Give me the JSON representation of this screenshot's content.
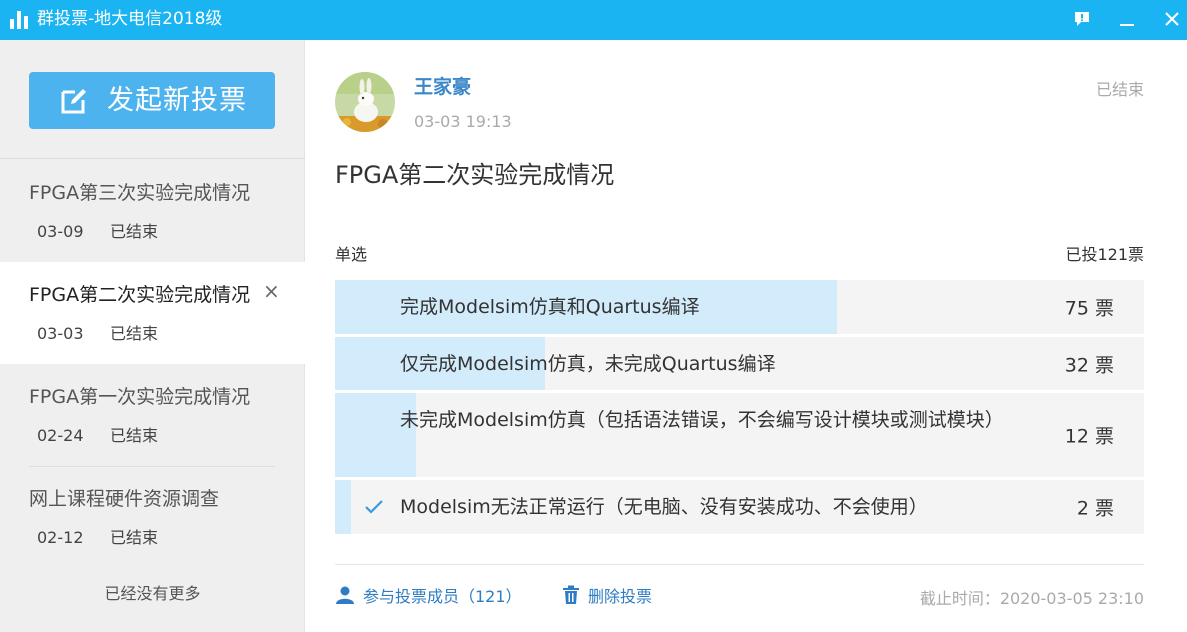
{
  "window": {
    "title": "群投票-地大电信2018级",
    "icon": "bar-chart-icon",
    "controls": [
      "feedback-icon",
      "minimize-icon",
      "close-icon"
    ],
    "accent": "#19b4f1"
  },
  "sidebar": {
    "new_vote_label": "发起新投票",
    "items": [
      {
        "title": "FPGA第三次实验完成情况",
        "date": "03-09",
        "status": "已结束",
        "active": false
      },
      {
        "title": "FPGA第二次实验完成情况",
        "date": "03-03",
        "status": "已结束",
        "active": true,
        "remove": "×"
      },
      {
        "title": "FPGA第一次实验完成情况",
        "date": "02-24",
        "status": "已结束",
        "active": false
      },
      {
        "title": "网上课程硬件资源调查",
        "date": "02-12",
        "status": "已结束",
        "active": false
      }
    ],
    "no_more": "已经没有更多"
  },
  "main": {
    "author": "王家豪",
    "post_time": "03-03 19:13",
    "state": "已结束",
    "title": "FPGA第二次实验完成情况",
    "vote_type": "单选",
    "total": "已投121票",
    "options": [
      {
        "label": "完成Modelsim仿真和Quartus编译",
        "count": "75 票",
        "fraction": 0.62,
        "checked": false
      },
      {
        "label": "仅完成Modelsim仿真，未完成Quartus编译",
        "count": "32 票",
        "fraction": 0.26,
        "checked": false
      },
      {
        "label": "未完成Modelsim仿真（包括语法错误，不会编写设计模块或测试模块）",
        "count": "12 票",
        "fraction": 0.1,
        "checked": false
      },
      {
        "label": "Modelsim无法正常运行（无电脑、没有安装成功、不会使用）",
        "count": "2 票",
        "fraction": 0.02,
        "checked": true
      }
    ],
    "members_link": "参与投票成员（121）",
    "delete_link": "删除投票",
    "deadline": "截止时间：2020-03-05 23:10"
  },
  "colors": {
    "fill": "#d3ecfb",
    "link": "#2e7cc4",
    "button": "#4db3ee"
  }
}
